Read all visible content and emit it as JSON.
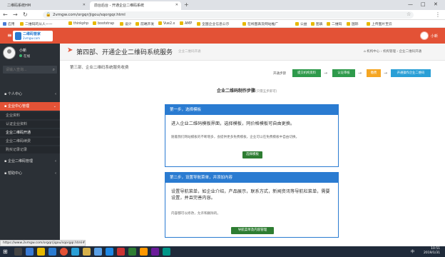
{
  "browser": {
    "tabs": [
      {
        "label": "二维码系统HM"
      },
      {
        "label": "前台后台 - 开通企业二维码系统"
      }
    ],
    "new_tab_icon": "plus-icon",
    "address": "2vmgw.com/orgqr/jigou/sqorgqr.html",
    "bookmarks": [
      "应用",
      "二维码的从人——",
      "thinkphp",
      "bootstrap",
      "设计",
      "前端开发",
      "Vue2.x",
      "AMP",
      "全国企业信息公示",
      "在线图表及网站推广",
      "公益",
      "图表",
      "二维码",
      "国际",
      "上传图片至云"
    ]
  },
  "header": {
    "logo_line1": "二维码管家",
    "logo_line2": "2vmgw.com",
    "user_name": "小新"
  },
  "sidebar": {
    "user_name": "小新",
    "status": "在线",
    "search_placeholder": "请输入查询...",
    "sections": [
      {
        "label": "个人中心"
      },
      {
        "label": "企业中心管理"
      },
      {
        "label": "企业二维码管理"
      },
      {
        "label": "帮助中心"
      }
    ],
    "sub_items": [
      "企业资料",
      "认证企业资料",
      "企业二维码开通",
      "企业二维码续费",
      "购买记录记录"
    ]
  },
  "main": {
    "title": "第四部、开通企业二维码系统服务",
    "title_sub": "企业二维码开通",
    "breadcrumb": [
      "机构中心",
      "机构管理",
      "企业二维码开通"
    ],
    "subtitle": "第三部、企业二维码系统服务收费",
    "steps_label": "开通步骤",
    "steps": [
      {
        "label": "提交机构资料"
      },
      {
        "label": "认证审核"
      },
      {
        "label": "缴费"
      },
      {
        "label": "开通操作企业二维码"
      }
    ],
    "flow_title": "企业二维码制作步骤",
    "flow_title_note": "(只需五步即可)"
  },
  "cards": [
    {
      "header": "第一步，选择模板",
      "text": "进入企业二维码模板界面，选择模板，同价格模板可自由更换。",
      "note": "随着我们网站模板的不断增多，会提供更多免费模板，企业可以在免费模板中自由切换。",
      "button": "选择模板"
    },
    {
      "header": "第二步，设置导航菜单，并添加内容",
      "text": "设置导航菜单，如企业介绍，产品展示，联系方式，新闻资讯等导航栏菜单，需要设置，并且完善内容。",
      "note": "内容都可以修改，允许和删除的。",
      "button": "导航菜单及内容管理"
    }
  ],
  "status_url": "https://www.2vmgw.com/orgqr/jigou/sqorgqr.html#",
  "taskbar": {
    "lang": "中",
    "time": "10:51",
    "date": "2019/1/31"
  },
  "colors": {
    "accent_red": "#e35236",
    "primary_blue": "#2a7bd1",
    "success_green": "#2e7d32",
    "warn_orange": "#f5a623"
  }
}
